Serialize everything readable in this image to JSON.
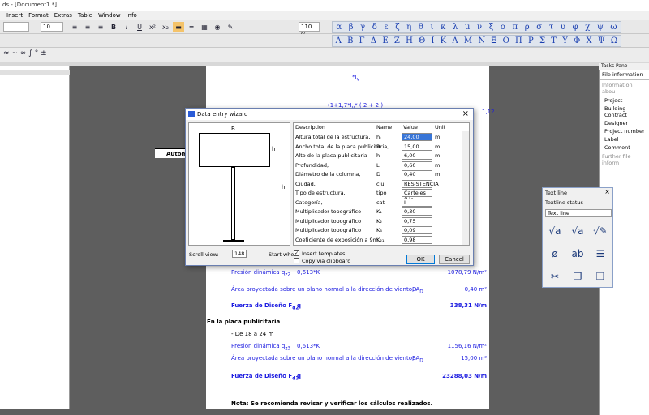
{
  "window": {
    "title": "ds - [Document1 *]"
  },
  "menu": [
    "Insert",
    "Format",
    "Extras",
    "Table",
    "Window",
    "Info"
  ],
  "toolbar": {
    "font_size": "10",
    "zoom": "110 %"
  },
  "greek_lower": [
    "α",
    "β",
    "γ",
    "δ",
    "ε",
    "ζ",
    "η",
    "θ",
    "ι",
    "κ",
    "λ",
    "μ",
    "ν",
    "ξ",
    "ο",
    "π",
    "ρ",
    "σ",
    "τ",
    "υ",
    "φ",
    "χ",
    "ψ",
    "ω"
  ],
  "greek_upper": [
    "Α",
    "Β",
    "Γ",
    "Δ",
    "Ε",
    "Ζ",
    "Η",
    "Θ",
    "Ι",
    "Κ",
    "Λ",
    "Μ",
    "Ν",
    "Ξ",
    "Ο",
    "Π",
    "Ρ",
    "Σ",
    "Τ",
    "Υ",
    "Φ",
    "Χ",
    "Ψ",
    "Ω"
  ],
  "document": {
    "top_value": "1,12",
    "autom": "Autom",
    "rows": [
      {
        "label": "Presión dinámica q",
        "sub": "z2",
        "formula": "0,613*K",
        "result": "1078,79 N/m²",
        "style": "blue"
      },
      {
        "label": "Área proyectada sobre un plano normal a la dirección de viento, A",
        "sub": "D",
        "var": "D",
        "result": "0,40 m²",
        "style": "blue"
      },
      {
        "label": "Fuerza de Diseño F",
        "sub": "d2",
        "formula": "q",
        "result": "338,31 N/m",
        "style": "bold"
      },
      {
        "label": "En la placa publicitaria",
        "style": "heading"
      },
      {
        "label": "- De 18 a 24 m",
        "style": "plain"
      },
      {
        "label": "Presión dinámica q",
        "sub": "z3",
        "formula": "0,613*K",
        "result": "1156,16 N/m²",
        "style": "blue"
      },
      {
        "label": "Área proyectada sobre un plano normal a la dirección de viento, A",
        "sub": "D",
        "var": "B",
        "result": "15,00 m²",
        "style": "blue"
      },
      {
        "label": "Fuerza de Diseño F",
        "sub": "d3",
        "formula": "q",
        "result": "23288,03 N/m",
        "style": "bold"
      },
      {
        "label": "Nota: Se recomienda revisar y verificar los cálculos realizados.",
        "style": "bold"
      }
    ]
  },
  "dialog": {
    "title": "Data entry wizard",
    "headers": {
      "description": "Description",
      "name": "Name",
      "value": "Value",
      "unit": "Unit"
    },
    "fig": {
      "b": "B",
      "h": "h",
      "ht": "h"
    },
    "rows": [
      {
        "d": "Altura total de la estructura,",
        "n": "hₜ",
        "v": "24,00",
        "u": "m"
      },
      {
        "d": "Ancho total de la placa publicitaria,",
        "n": "B",
        "v": "15,00",
        "u": "m"
      },
      {
        "d": "Alto de la placa publicitaria",
        "n": "h",
        "v": "6,00",
        "u": "m"
      },
      {
        "d": "Profundidad,",
        "n": "L",
        "v": "0,60",
        "u": "m"
      },
      {
        "d": "Diámetro de la columna,",
        "n": "D",
        "v": "0,40",
        "u": "m"
      },
      {
        "d": "Ciudad,",
        "n": "ciu",
        "v": "RESISTENCIA",
        "u": ""
      },
      {
        "d": "Tipo de estructura,",
        "n": "tipo",
        "v": "Carteles (Lle",
        "u": ""
      },
      {
        "d": "Categoría,",
        "n": "cat",
        "v": "I",
        "u": ""
      },
      {
        "d": "Multiplicador topográfico",
        "n": "K₁",
        "v": "0,30",
        "u": ""
      },
      {
        "d": "Multiplicador topográfico",
        "n": "K₂",
        "v": "0,75",
        "u": ""
      },
      {
        "d": "Multiplicador topográfico",
        "n": "K₃",
        "v": "0,09",
        "u": ""
      },
      {
        "d": "Coeficiente de exposición a 9m,",
        "n": "K₂₁",
        "v": "0,98",
        "u": ""
      }
    ],
    "scroll_label": "Scroll view:",
    "scroll_value": "148",
    "start_when": "Start when:",
    "insert_templates": "Insert templates",
    "copy_clipboard": "Copy via clipboard",
    "ok": "OK",
    "cancel": "Cancel"
  },
  "tasks": {
    "title": "Tasks Pane",
    "file_info": "File information",
    "section": "Information abou",
    "items": [
      "Project",
      "Building Contract",
      "Designer",
      "Project number",
      "Label",
      "Comment"
    ],
    "further": "Further file inform"
  },
  "textline": {
    "title": "Text line",
    "status": "Textline status",
    "select": "Text line"
  }
}
